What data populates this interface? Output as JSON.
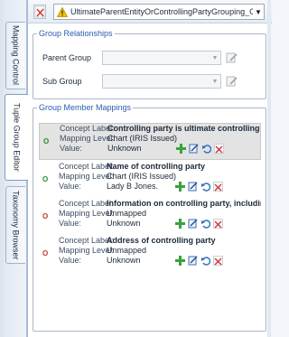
{
  "sidebar": {
    "tabs": [
      {
        "label": "Mapping Control"
      },
      {
        "label": "Tuple Group Editor"
      },
      {
        "label": "Taxonomy Browser"
      }
    ]
  },
  "toolbar": {
    "group_value": "UltimateParentEntityOrControllingPartyGrouping_Group"
  },
  "relationships": {
    "legend": "Group Relationships",
    "parent_label": "Parent Group",
    "sub_label": "Sub Group"
  },
  "mappings": {
    "legend": "Group Member Mappings",
    "concept_prefix": "Concept Label:",
    "level_prefix": "Mapping Level:",
    "value_prefix": "Value:",
    "items": [
      {
        "status": "O",
        "concept": "Controlling party is ultimate controlling p...",
        "level": "Chart (IRIS Issued)",
        "value": "Unknown"
      },
      {
        "status": "O",
        "concept": "Name of controlling party",
        "level": "Chart (IRIS Issued)",
        "value": "Lady B Jones."
      },
      {
        "status": "O",
        "concept": "Information on controlling party, includin...",
        "level": "Unmapped",
        "value": "Unknown"
      },
      {
        "status": "O",
        "concept": "Address of controlling party",
        "level": "Unmapped",
        "value": "Unknown"
      }
    ]
  },
  "colors": {
    "status_ok": "#2a8a2a",
    "status_bad": "#c0392b",
    "legend": "#2a5db0"
  }
}
